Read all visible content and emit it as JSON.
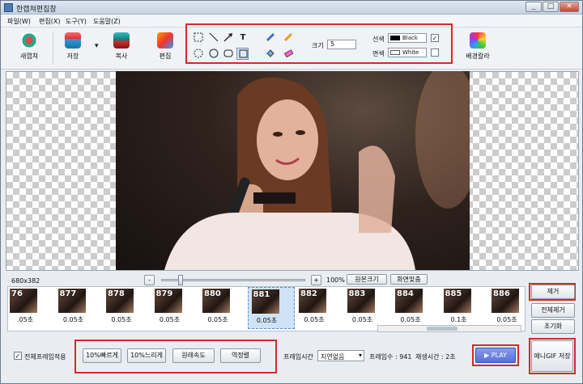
{
  "window": {
    "title": "한캡쳐편집창",
    "min": "_",
    "max": "□",
    "close": "✕"
  },
  "menu": [
    "파일(W)",
    "편집(X)",
    "도구(Y)",
    "도움말(Z)"
  ],
  "toolbar": {
    "new_capture": "새캡쳐",
    "save": "저장",
    "save_arrow": "▾",
    "copy": "복사",
    "edit": "편집",
    "bg_color": "배경칼라"
  },
  "draw": {
    "size_label": "크기",
    "size_value": "5",
    "line_color_label": "선색",
    "line_color_value": "Black",
    "fill_color_label": "면색",
    "fill_color_value": "White",
    "line_checked": "✓",
    "fill_checked": ""
  },
  "zoom": {
    "dimensions": "680x382",
    "minus": "-",
    "plus": "+",
    "zoom_percent": "100%",
    "original_size": "원본크기",
    "fit_screen": "화면맞춤",
    "slider_level": 0.12
  },
  "frames": [
    {
      "num": "76",
      "dur": ".05초"
    },
    {
      "num": "877",
      "dur": "0.05초"
    },
    {
      "num": "878",
      "dur": "0.05초"
    },
    {
      "num": "879",
      "dur": "0.05초"
    },
    {
      "num": "880",
      "dur": "0.05초"
    },
    {
      "num": "881",
      "dur": "0.05초",
      "selected": true
    },
    {
      "num": "882",
      "dur": "0.05초"
    },
    {
      "num": "883",
      "dur": "0.05초"
    },
    {
      "num": "884",
      "dur": "0.05초"
    },
    {
      "num": "885",
      "dur": "0.1초"
    },
    {
      "num": "886",
      "dur": "0.05초"
    }
  ],
  "side_buttons": {
    "remove": "제거",
    "remove_all": "전체제거",
    "reset": "초기화"
  },
  "bottom": {
    "apply_all_label": "전체프레임적용",
    "apply_all_checked": "✓",
    "faster": "10%빠르게",
    "slower": "10%느리게",
    "original_speed": "원래속도",
    "reverse": "역정렬",
    "frame_time_label": "프레임시간",
    "frame_time_value": "지연없음",
    "frame_count": "프레임수 : 941",
    "play_time": "재생시간 : 2초",
    "play": "PLAY",
    "save_gif": "애니GIF 저장"
  },
  "colors": {
    "red_highlight": "#d42a2a",
    "play_button": "#5a6fd8"
  }
}
